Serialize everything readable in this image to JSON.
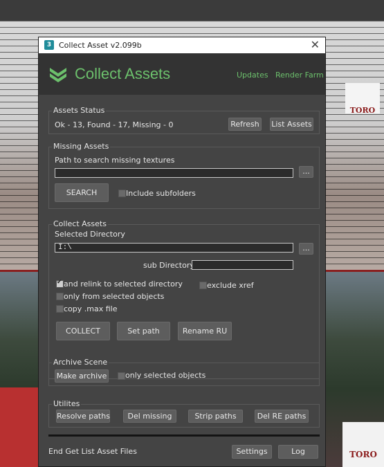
{
  "window": {
    "title": "Collect Asset v2.099b",
    "close_symbol": "✕"
  },
  "header": {
    "title": "Collect Assets",
    "links": {
      "updates": "Updates",
      "render_farm": "Render Farm"
    },
    "accent": "#6cc06c"
  },
  "assets_status": {
    "label": "Assets Status",
    "summary": "Ok - 13, Found - 17, Missing - 0",
    "refresh": "Refresh",
    "list_assets": "List Assets"
  },
  "missing_assets": {
    "label": "Missing Assets",
    "path_label": "Path to search missing textures",
    "path_value": "",
    "browse": "...",
    "search": "SEARCH",
    "include_subfolders": "Include subfolders",
    "include_subfolders_checked": false
  },
  "collect_assets": {
    "label": "Collect Assets",
    "selected_directory_label": "Selected Directory",
    "selected_directory_value": "I:\\",
    "browse": "...",
    "sub_directory_label": "sub Directory",
    "sub_directory_value": "",
    "relink": "and relink to selected directory",
    "relink_checked": true,
    "exclude_xref": "exclude xref",
    "exclude_xref_checked": false,
    "only_selected": "only from selected objects",
    "only_selected_checked": false,
    "copy_max": "copy .max file",
    "copy_max_checked": false,
    "collect": "COLLECT",
    "set_path": "Set path",
    "rename_ru": "Rename RU"
  },
  "archive_scene": {
    "label": "Archive Scene",
    "make_archive": "Make archive",
    "only_selected": "only selected objects",
    "only_selected_checked": false
  },
  "utilities": {
    "label": "Utilites",
    "resolve_paths": "Resolve paths",
    "del_missing": "Del missing",
    "strip_paths": "Strip paths",
    "del_re_paths": "Del RE paths"
  },
  "footer": {
    "status": "End Get List Asset Files",
    "settings": "Settings",
    "log": "Log"
  },
  "viewport": {
    "sign_text": "TORO",
    "sign_text_lower": "TORO"
  }
}
